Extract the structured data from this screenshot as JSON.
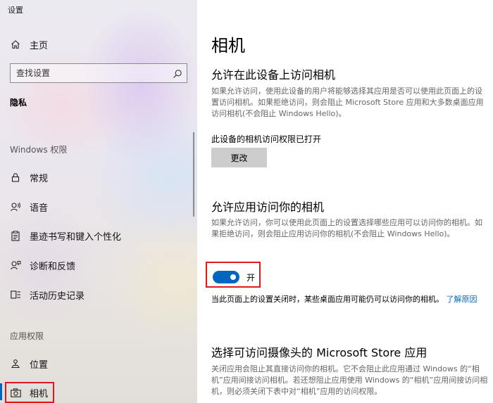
{
  "app": {
    "title": "设置"
  },
  "sidebar": {
    "home": {
      "label": "主页",
      "icon": "home-icon"
    },
    "search": {
      "placeholder": "查找设置",
      "icon": "search-icon"
    },
    "section": "隐私",
    "groups": [
      {
        "label": "Windows 权限",
        "items": [
          {
            "label": "常规",
            "icon": "lock-icon"
          },
          {
            "label": "语音",
            "icon": "speech-icon"
          },
          {
            "label": "墨迹书写和键入个性化",
            "icon": "inking-icon"
          },
          {
            "label": "诊断和反馈",
            "icon": "feedback-icon"
          },
          {
            "label": "活动历史记录",
            "icon": "activity-history-icon"
          }
        ]
      },
      {
        "label": "应用权限",
        "items": [
          {
            "label": "位置",
            "icon": "location-icon"
          },
          {
            "label": "相机",
            "icon": "camera-icon",
            "selected": true
          }
        ]
      }
    ]
  },
  "main": {
    "title": "相机",
    "device_access": {
      "heading": "允许在此设备上访问相机",
      "description": "如果允许访问，使用此设备的用户将能够选择其应用是否可以使用此页面上的设置访问相机。如果拒绝访问，则会阻止 Microsoft Store 应用和大多数桌面应用访问相机(不会阻止 Windows Hello)。",
      "status": "此设备的相机访问权限已打开",
      "button_label": "更改"
    },
    "app_access": {
      "heading": "允许应用访问你的相机",
      "description": "如果允许访问，你可以使用此页面上的设置选择哪些应用可以访问你的相机。如果拒绝访问，则会阻止应用访问你的相机(不会阻止 Windows Hello)。",
      "toggle_state": "开",
      "toggle_on": true,
      "note": "当此页面上的设置关闭时，某些桌面应用可能仍可以访问你的相机。",
      "link": "了解原因"
    },
    "store_apps": {
      "heading": "选择可访问摄像头的 Microsoft Store 应用",
      "description": "关闭应用会阻止其直接访问你的相机。它不会阻止此应用通过 Windows 的“相机”应用间接访问相机。若还想阻止应用使用 Windows 的“相机”应用间接访问相机，则必须关闭下表中对“相机”应用的访问权限。"
    }
  },
  "colors": {
    "accent": "#0067c0",
    "highlight": "#e0191c",
    "button": "#cccccc"
  }
}
